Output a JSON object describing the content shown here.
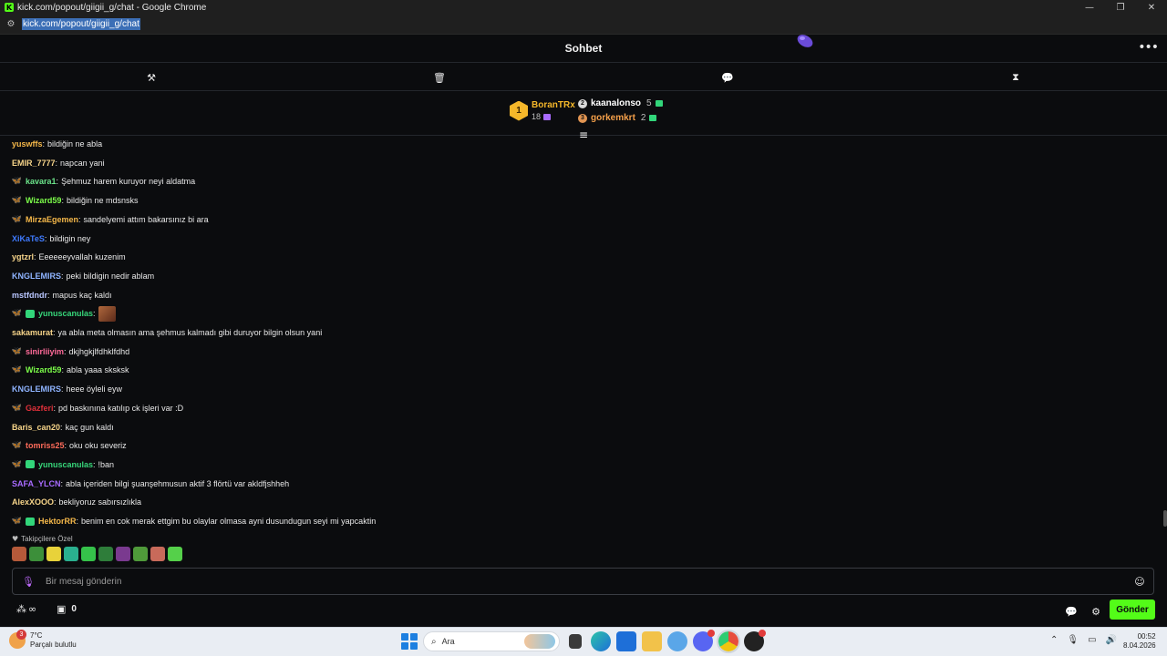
{
  "window": {
    "title": "kick.com/popout/giigii_g/chat - Google Chrome",
    "url": "kick.com/popout/giigii_g/chat"
  },
  "header": {
    "title": "Sohbet"
  },
  "leaderboard": {
    "first": {
      "rank": "1",
      "name": "BoranTRx",
      "count": "18",
      "color": "#f5b72a"
    },
    "others": [
      {
        "name": "kaanalonso",
        "count": "5",
        "color": "#ffffff",
        "rank_color": "#d9d9d9"
      },
      {
        "name": "gorkemkrt",
        "count": "2",
        "color": "#f5a04a",
        "rank_color": "#e29552"
      }
    ]
  },
  "messages": [
    {
      "user": "yuswffs",
      "text": "bildiğin ne abla",
      "color": "#f5b84a",
      "badges": []
    },
    {
      "user": "EMIR_7777",
      "text": "napcan yani",
      "color": "#f7d58a",
      "badges": []
    },
    {
      "user": "kavara1",
      "text": "Şehmuz harem kuruyor neyi aldatma",
      "color": "#6be38a",
      "badges": [
        "sub"
      ]
    },
    {
      "user": "Wizard59",
      "text": "bildiğin ne mdsnsks",
      "color": "#7dff4a",
      "badges": [
        "sub"
      ]
    },
    {
      "user": "MirzaEgemen",
      "text": "sandelyemi attım bakarsınız bi ara",
      "color": "#f5b84a",
      "badges": [
        "sub"
      ]
    },
    {
      "user": "XiKaTeS",
      "text": "bildigin ney",
      "color": "#3f7bff",
      "badges": []
    },
    {
      "user": "ygtzrl",
      "text": "Eeeeeeyvallah kuzenim",
      "color": "#f7d58a",
      "badges": []
    },
    {
      "user": "KNGLEMIRS",
      "text": "peki bildigin nedir ablam",
      "color": "#8fb4ff",
      "badges": []
    },
    {
      "user": "mstfdndr",
      "text": "mapus kaç kaldı",
      "color": "#b9c6ff",
      "badges": []
    },
    {
      "user": "yunuscanulas",
      "text": "",
      "color": "#37d67a",
      "badges": [
        "sub",
        "gift"
      ],
      "emote": true
    },
    {
      "user": "sakamurat",
      "text": "ya abla meta olmasın ama şehmus kalmadı gibi duruyor bilgin olsun yani",
      "color": "#f7d58a",
      "badges": []
    },
    {
      "user": "sinirliiyim",
      "text": "dkjhgkjlfdhklfdhd",
      "color": "#ff6b9a",
      "badges": [
        "sub"
      ]
    },
    {
      "user": "Wizard59",
      "text": "abla yaaa sksksk",
      "color": "#7dff4a",
      "badges": [
        "sub"
      ]
    },
    {
      "user": "KNGLEMIRS",
      "text": "heee öyleli eyw",
      "color": "#8fb4ff",
      "badges": []
    },
    {
      "user": "Gazferi",
      "text": "pd baskınına katılıp ck işleri var :D",
      "color": "#e0303a",
      "badges": [
        "sub"
      ]
    },
    {
      "user": "Baris_can20",
      "text": "kaç gun kaldı",
      "color": "#f7d58a",
      "badges": []
    },
    {
      "user": "tomriss25",
      "text": "oku oku severiz",
      "color": "#ff6b5a",
      "badges": [
        "sub-orange"
      ]
    },
    {
      "user": "yunuscanulas",
      "text": "!ban",
      "color": "#37d67a",
      "badges": [
        "sub",
        "gift"
      ]
    },
    {
      "user": "SAFA_YLCN",
      "text": "abla içeriden bilgi şuanşehmusun aktif 3 flörtü var akldfjshheh",
      "color": "#a86bff",
      "badges": []
    },
    {
      "user": "AlexXOOO",
      "text": "bekliyoruz sabırsızlıkla",
      "color": "#f7d58a",
      "badges": []
    },
    {
      "user": "HektorRR",
      "text": "benim en cok merak ettgim bu olaylar olmasa ayni dusundugun seyi mi yapcaktin",
      "color": "#f5b84a",
      "badges": [
        "sub",
        "gift"
      ]
    }
  ],
  "emotes": {
    "label": "Takipçilere Özel",
    "colors": [
      "#b55a3a",
      "#3c8f3a",
      "#e8d23a",
      "#2ab08f",
      "#35c24a",
      "#2e7d3a",
      "#7a3a8f",
      "#4f9a3a",
      "#c86a5a",
      "#55d04a"
    ]
  },
  "input": {
    "placeholder": "Bir mesaj gönderin"
  },
  "footer": {
    "shop_count": "0",
    "send_label": "Gönder"
  },
  "taskbar": {
    "temp": "7°C",
    "weather": "Parçalı bulutlu",
    "weather_badge": "3",
    "search": "Ara",
    "time": "00:52",
    "date": "8.04.2026"
  }
}
